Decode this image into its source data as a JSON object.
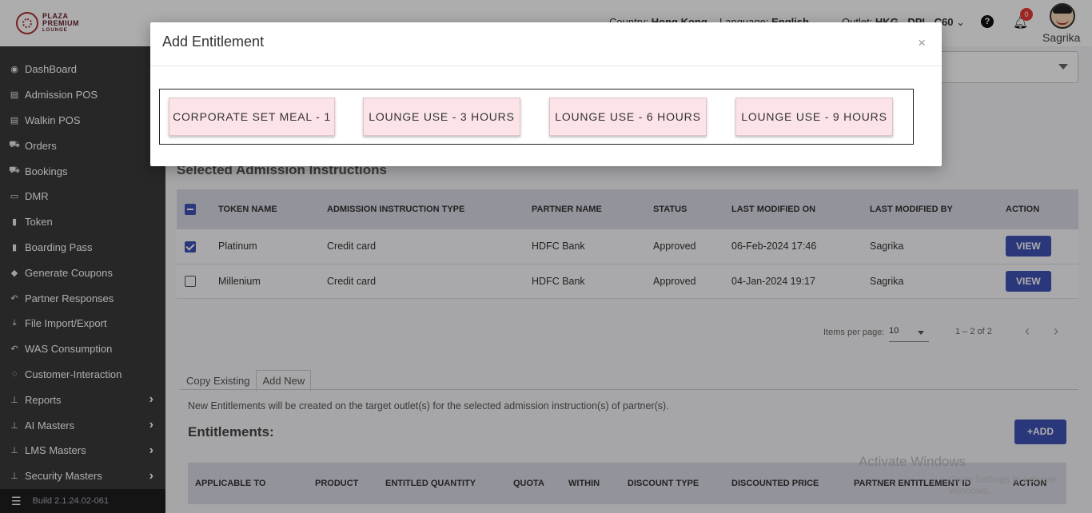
{
  "header": {
    "country_label": "Country:",
    "country_value": "Hong Kong",
    "language_label": "Language:",
    "language_value": "English",
    "outlet_label": "Outlet:",
    "outlet_value": "HKG - DPI - C60",
    "notification_count": "0",
    "user_name": "Sagrika"
  },
  "sidebar": {
    "logo_line1": "PLAZA",
    "logo_line2": "PREMIUM",
    "logo_line3": "LOUNGE",
    "items": [
      {
        "label": "DashBoard",
        "icon": "dashboard-icon"
      },
      {
        "label": "Admission POS",
        "icon": "card-icon"
      },
      {
        "label": "Walkin POS",
        "icon": "card-icon"
      },
      {
        "label": "Orders",
        "icon": "cart-icon"
      },
      {
        "label": "Bookings",
        "icon": "cart-icon"
      },
      {
        "label": "DMR",
        "icon": "calendar-icon"
      },
      {
        "label": "Token",
        "icon": "file-icon"
      },
      {
        "label": "Boarding Pass",
        "icon": "file-icon"
      },
      {
        "label": "Generate Coupons",
        "icon": "tag-icon"
      },
      {
        "label": "Partner Responses",
        "icon": "reply-icon"
      },
      {
        "label": "File Import/Export",
        "icon": "download-icon"
      },
      {
        "label": "WAS Consumption",
        "icon": "reply-icon"
      },
      {
        "label": "Customer-Interaction",
        "icon": "chat-icon"
      },
      {
        "label": "Reports",
        "icon": "sitemap-icon"
      },
      {
        "label": "AI Masters",
        "icon": "sitemap-icon"
      },
      {
        "label": "LMS Masters",
        "icon": "sitemap-icon"
      },
      {
        "label": "Security Masters",
        "icon": "sitemap-icon"
      }
    ],
    "build": "Build 2.1.24.02-061"
  },
  "main": {
    "section_title": "Selected Admission Instructions",
    "table": {
      "headers": [
        "TOKEN NAME",
        "ADMISSION INSTRUCTION TYPE",
        "PARTNER NAME",
        "STATUS",
        "LAST MODIFIED ON",
        "LAST MODIFIED BY",
        "ACTION"
      ],
      "rows": [
        {
          "checked": true,
          "token": "Platinum",
          "type": "Credit card",
          "partner": "HDFC Bank",
          "status": "Approved",
          "modified_on": "06-Feb-2024 17:46",
          "modified_by": "Sagrika",
          "action": "VIEW"
        },
        {
          "checked": false,
          "token": "Millenium",
          "type": "Credit card",
          "partner": "HDFC Bank",
          "status": "Approved",
          "modified_on": "04-Jan-2024 19:17",
          "modified_by": "Sagrika",
          "action": "VIEW"
        }
      ]
    },
    "paginator": {
      "items_per_page_label": "Items per page:",
      "items_per_page_value": "10",
      "range_label": "1 – 2 of 2"
    },
    "tabs": [
      "Copy Existing",
      "Add New"
    ],
    "info_text": "New Entitlements will be created on the target outlet(s) for the selected admission instruction(s) of partner(s).",
    "entitlements_title": "Entitlements:",
    "add_button": "ADD",
    "entitlement_headers": [
      "APPLICABLE TO",
      "PRODUCT",
      "ENTITLED QUANTITY",
      "QUOTA",
      "WITHIN",
      "DISCOUNT TYPE",
      "DISCOUNTED PRICE",
      "PARTNER ENTITLEMENT ID",
      "ACTION"
    ],
    "watermark_line1": "Activate Windows",
    "watermark_line2": "Go to Settings to activate Windows."
  },
  "modal": {
    "title": "Add Entitlement",
    "close": "×",
    "options": [
      "CORPORATE SET MEAL - 1",
      "LOUNGE USE - 3 HOURS",
      "LOUNGE USE - 6 HOURS",
      "LOUNGE USE - 9 HOURS"
    ]
  },
  "colors": {
    "sidebar_bg": "#3a3a3a",
    "primary": "#3f51b5",
    "badge": "#e53935",
    "option_card": "#fbe3e8",
    "table_header": "#d9d9e6"
  }
}
